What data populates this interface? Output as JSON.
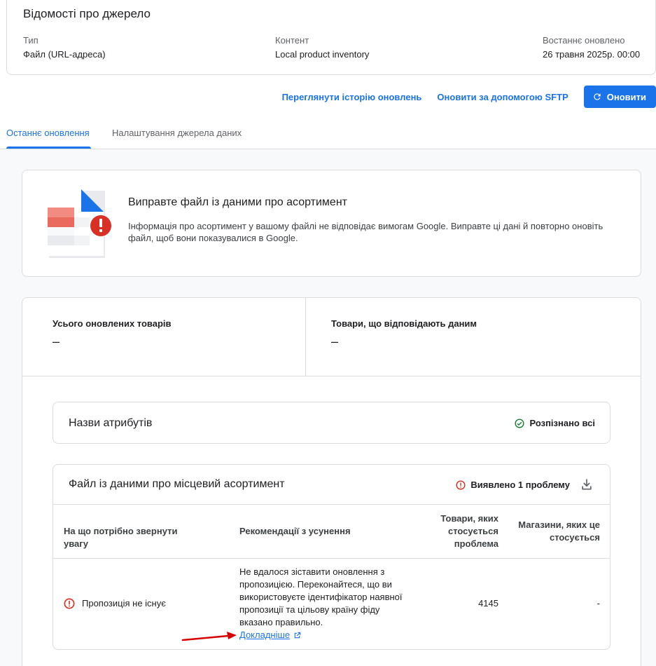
{
  "source_info": {
    "title": "Відомості про джерело",
    "type_label": "Тип",
    "type_value": "Файл (URL-адреса)",
    "content_label": "Контент",
    "content_value": "Local product inventory",
    "updated_label": "Востаннє оновлено",
    "updated_value": "26 травня 2025р. 00:00"
  },
  "actions": {
    "history": "Переглянути історію оновлень",
    "sftp": "Оновити за допомогою SFTP",
    "refresh": "Оновити"
  },
  "tabs": [
    {
      "label": "Останнє оновлення",
      "active": true
    },
    {
      "label": "Налаштування джерела даних",
      "active": false
    }
  ],
  "alert": {
    "title": "Виправте файл із даними про асортимент",
    "text": "Інформація про асортимент у вашому файлі не відповідає вимогам Google. Виправте ці дані й повторно оновіть файл, щоб вони показувалися в Google."
  },
  "stats": {
    "total_label": "Усього оновлених товарів",
    "total_value": "–",
    "matched_label": "Товари, що відповідають даним",
    "matched_value": "–"
  },
  "attributes": {
    "title": "Назви атрибутів",
    "status": "Розпізнано всі"
  },
  "file": {
    "title": "Файл із даними про місцевий асортимент",
    "status": "Виявлено 1 проблему",
    "columns": [
      "На що потрібно звернути увагу",
      "Рекомендації з усунення",
      "Товари, яких стосується проблема",
      "Магазини, яких це стосується"
    ],
    "rows": [
      {
        "issue": "Пропозиція не існує",
        "fix": "Не вдалося зіставити оновлення з пропозицією. Переконайтеся, що ви використовуєте ідентифікатор наявної пропозиції та цільову країну фіду вказано правильно.",
        "link": "Докладніше",
        "products": "4145",
        "stores": "-"
      }
    ]
  },
  "colors": {
    "accent": "#1a73e8",
    "error": "#d93025",
    "success": "#188038",
    "arrow": "#d50000"
  },
  "icons": [
    "refresh-icon",
    "document-error-illustration",
    "check-circle-icon",
    "error-icon",
    "download-icon",
    "external-link-icon",
    "arrow-annotation"
  ]
}
